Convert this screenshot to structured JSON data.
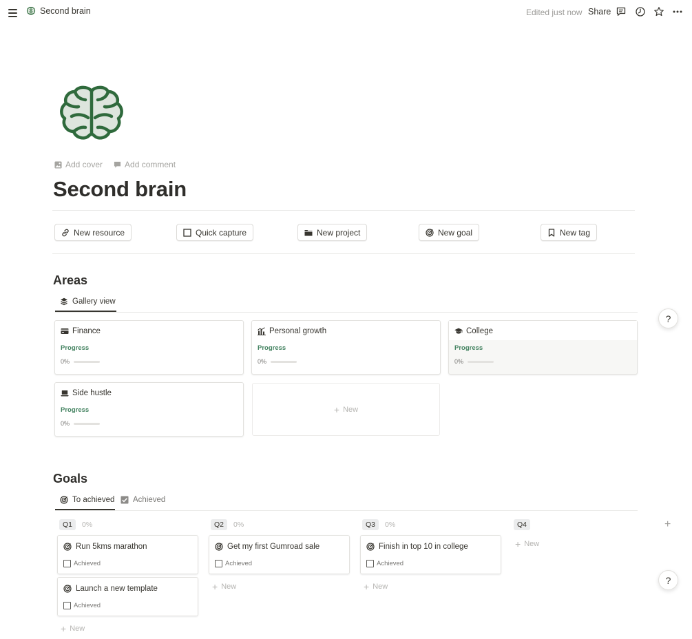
{
  "topbar": {
    "breadcrumb": "Second brain",
    "edited": "Edited just now",
    "share": "Share"
  },
  "page": {
    "title": "Second brain",
    "add_cover": "Add cover",
    "add_comment": "Add comment"
  },
  "quick_actions": [
    {
      "label": "New resource",
      "icon": "link-icon"
    },
    {
      "label": "Quick capture",
      "icon": "checkbox-icon"
    },
    {
      "label": "New project",
      "icon": "folder-icon"
    },
    {
      "label": "New goal",
      "icon": "target-icon"
    },
    {
      "label": "New tag",
      "icon": "bookmark-icon"
    }
  ],
  "areas": {
    "heading": "Areas",
    "view_tab": "Gallery view",
    "property_label": "Progress",
    "cards": [
      {
        "title": "Finance",
        "icon": "credit-card-icon",
        "progress_text": "0%",
        "progress": 0
      },
      {
        "title": "Personal growth",
        "icon": "chart-icon",
        "progress_text": "0%",
        "progress": 0
      },
      {
        "title": "College",
        "icon": "graduation-cap-icon",
        "progress_text": "0%",
        "progress": 0
      },
      {
        "title": "Side hustle",
        "icon": "laptop-icon",
        "progress_text": "0%",
        "progress": 0
      }
    ],
    "new_label": "New"
  },
  "goals": {
    "heading": "Goals",
    "tabs": [
      "To achieved",
      "Achieved"
    ],
    "checkbox_label": "Achieved",
    "new_label": "New",
    "columns": [
      {
        "name": "Q1",
        "pct": "0%",
        "cards": [
          "Run 5kms marathon",
          "Launch a new template"
        ]
      },
      {
        "name": "Q2",
        "pct": "0%",
        "cards": [
          "Get my first Gumroad sale"
        ]
      },
      {
        "name": "Q3",
        "pct": "0%",
        "cards": [
          "Finish in top 10 in college"
        ]
      },
      {
        "name": "Q4",
        "pct": "",
        "cards": []
      }
    ]
  },
  "help": "?",
  "colors": {
    "accent_green": "#448361",
    "brain_green": "#2f6a3c",
    "text": "#37352f"
  }
}
